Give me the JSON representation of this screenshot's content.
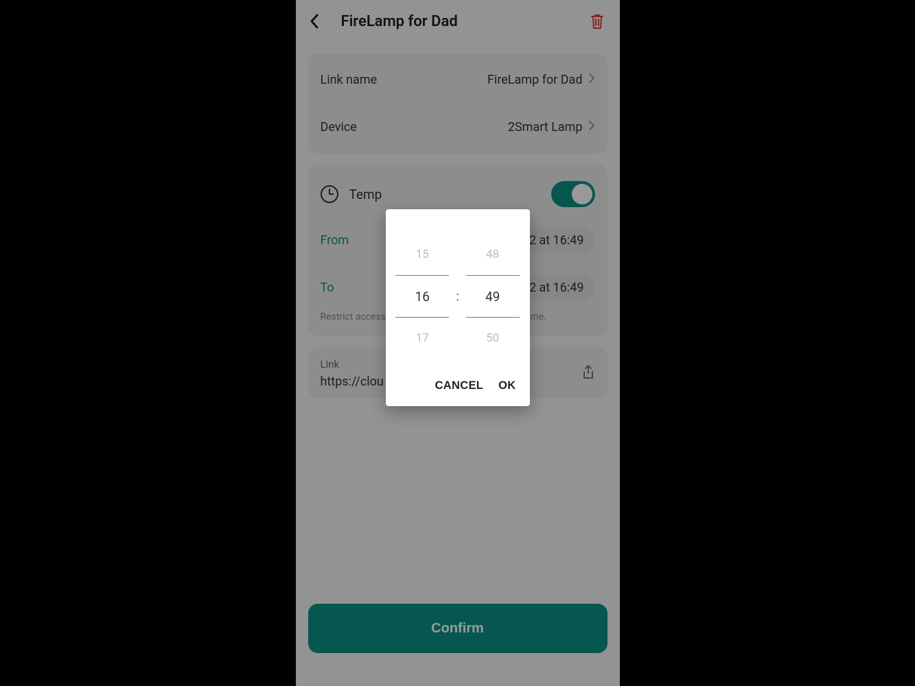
{
  "header": {
    "title": "FireLamp for Dad"
  },
  "details": {
    "link_name_label": "Link name",
    "link_name_value": "FireLamp for Dad",
    "device_label": "Device",
    "device_value": "2Smart Lamp"
  },
  "temporary": {
    "label": "Temp",
    "from_label": "From",
    "from_value": "2 at 16:49",
    "to_label": "To",
    "to_value": "2 at 16:49",
    "hint_prefix": "Restrict access",
    "hint_suffix": "ime."
  },
  "link": {
    "label": "Link",
    "url": "https://clou                                           e-IFs…"
  },
  "confirm": "Confirm",
  "picker": {
    "hour_prev": "15",
    "hour": "16",
    "hour_next": "17",
    "minute_prev": "48",
    "minute": "49",
    "minute_next": "50",
    "colon": ":",
    "cancel": "CANCEL",
    "ok": "OK"
  }
}
